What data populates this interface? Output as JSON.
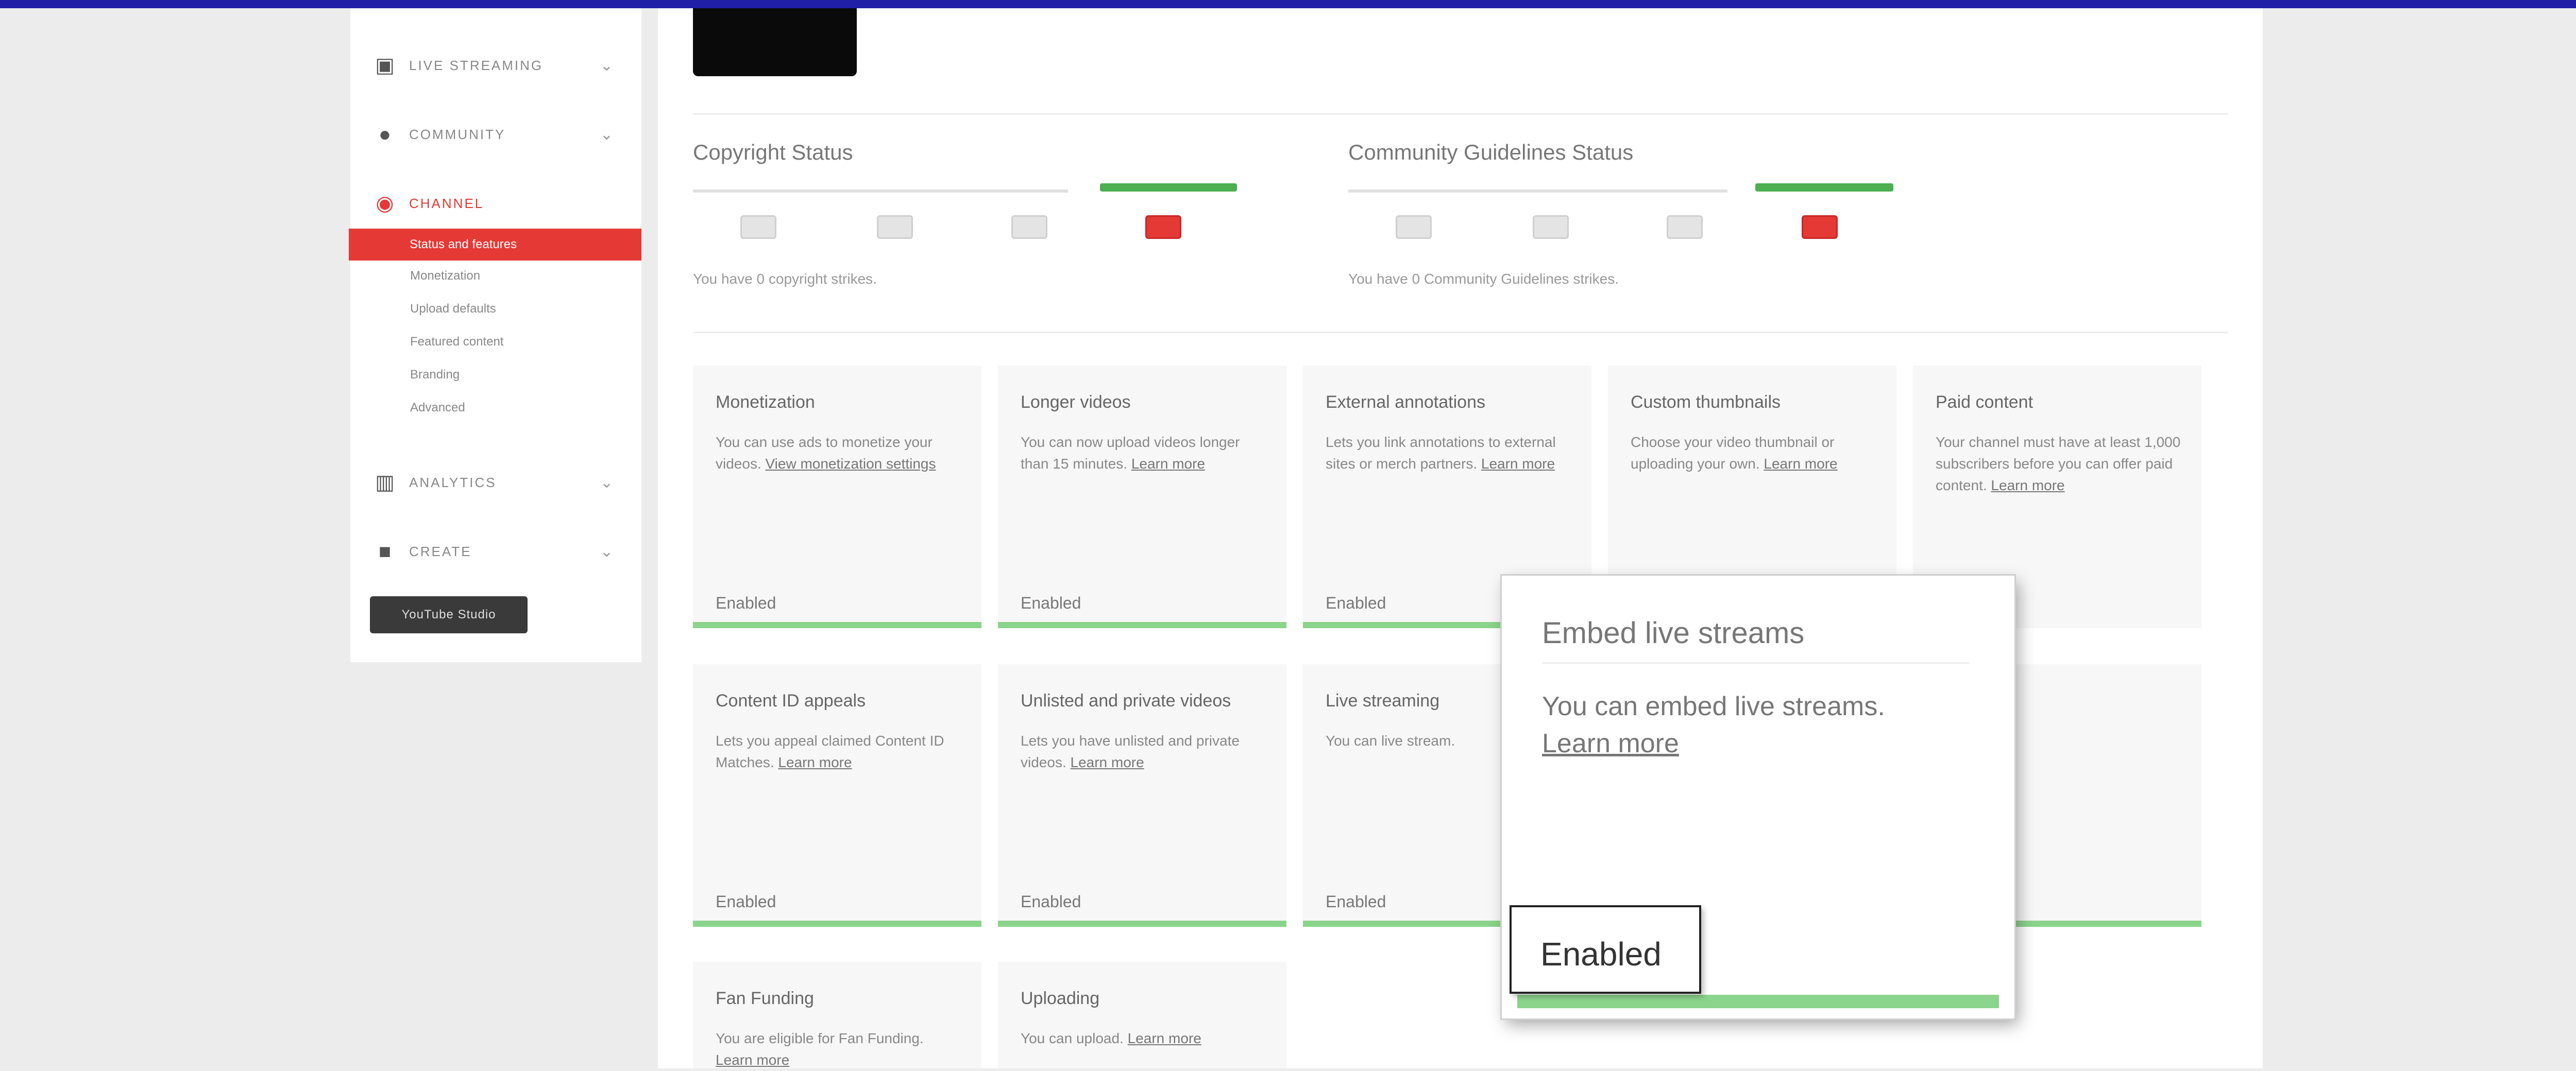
{
  "sidebar": {
    "items": [
      {
        "label": "LIVE STREAMING",
        "icon": "video-icon"
      },
      {
        "label": "COMMUNITY",
        "icon": "people-icon"
      },
      {
        "label": "CHANNEL",
        "icon": "channel-icon"
      },
      {
        "label": "ANALYTICS",
        "icon": "analytics-icon"
      },
      {
        "label": "CREATE",
        "icon": "camera-icon"
      }
    ],
    "subitems": [
      "Status and features",
      "Monetization",
      "Upload defaults",
      "Featured content",
      "Branding",
      "Advanced"
    ],
    "creator_button": "YouTube Studio"
  },
  "main": {
    "copyright": {
      "title": "Copyright Status",
      "description": "You have 0 copyright strikes."
    },
    "community": {
      "title": "Community Guidelines Status",
      "description": "You have 0 Community Guidelines strikes."
    },
    "cards": [
      {
        "title": "Monetization",
        "body": "You can use ads to monetize your videos.",
        "link": "View monetization settings",
        "status": "Enabled"
      },
      {
        "title": "Longer videos",
        "body": "You can now upload videos longer than 15 minutes.",
        "link": "Learn more",
        "status": "Enabled"
      },
      {
        "title": "External annotations",
        "body": "Lets you link annotations to external sites or merch partners.",
        "link": "Learn more",
        "status": "Enabled"
      },
      {
        "title": "Custom thumbnails",
        "body": "Choose your video thumbnail or uploading your own.",
        "link": "Learn more",
        "status": ""
      },
      {
        "title": "Paid content",
        "body": "Your channel must have at least 1,000 subscribers before you can offer paid content.",
        "link": "Learn more",
        "status": ""
      },
      {
        "title": "Content ID appeals",
        "body": "Lets you appeal claimed Content ID Matches.",
        "link": "Learn more",
        "status": "Enabled"
      },
      {
        "title": "Unlisted and private videos",
        "body": "Lets you have unlisted and private videos.",
        "link": "Learn more",
        "status": "Enabled"
      },
      {
        "title": "Live streaming",
        "body": "You can live stream.",
        "link": "",
        "status": "Enabled"
      },
      {
        "title": "Fan Funding",
        "body": "You are eligible for Fan Funding.",
        "link": "Learn more",
        "status": ""
      },
      {
        "title": "Uploading",
        "body": "You can upload.",
        "link": "Learn more",
        "status": ""
      }
    ]
  },
  "popup": {
    "title": "Embed live streams",
    "body": "You can embed live streams.",
    "link": "Learn more",
    "status": "Enabled"
  }
}
